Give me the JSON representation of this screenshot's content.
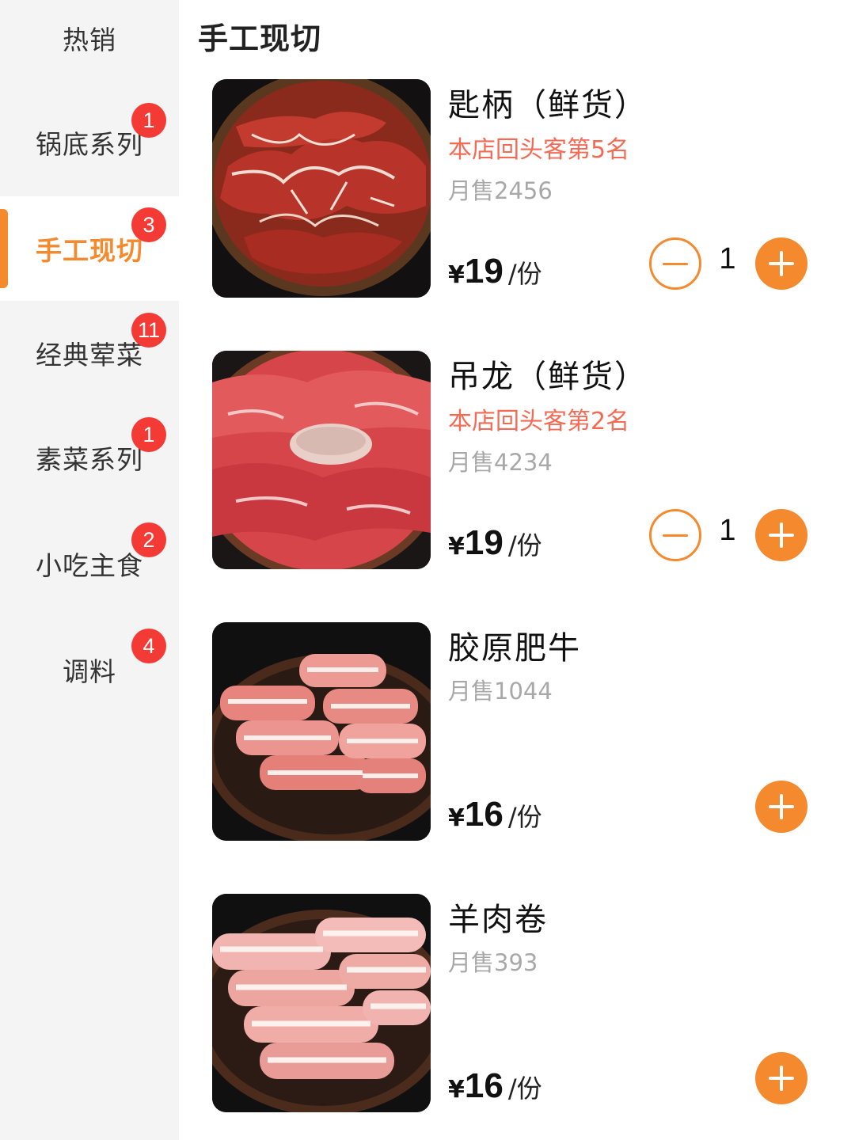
{
  "sidebar": {
    "categories": [
      {
        "label": "热销",
        "badge": ""
      },
      {
        "label": "锅底系列",
        "badge": "1"
      },
      {
        "label": "手工现切",
        "badge": "3",
        "active": true
      },
      {
        "label": "经典荤菜",
        "badge": "11"
      },
      {
        "label": "素菜系列",
        "badge": "1"
      },
      {
        "label": "小吃主食",
        "badge": "2"
      },
      {
        "label": "调料",
        "badge": "4"
      }
    ]
  },
  "section": {
    "title": "手工现切"
  },
  "products": [
    {
      "name": "匙柄（鲜货）",
      "rank": "本店回头客第5名",
      "sales": "月售2456",
      "currency": "¥",
      "price": "19",
      "unit": "/份",
      "quantity": "1",
      "image": "marbled-beef-plate"
    },
    {
      "name": "吊龙（鲜货）",
      "rank": "本店回头客第2名",
      "sales": "月售4234",
      "currency": "¥",
      "price": "19",
      "unit": "/份",
      "quantity": "1",
      "image": "sliced-beef-plate"
    },
    {
      "name": "胶原肥牛",
      "sales": "月售1044",
      "currency": "¥",
      "price": "16",
      "unit": "/份",
      "image": "beef-rolls-plate"
    },
    {
      "name": "羊肉卷",
      "sales": "月售393",
      "currency": "¥",
      "price": "16",
      "unit": "/份",
      "image": "lamb-rolls-plate"
    }
  ],
  "colors": {
    "accent": "#f5892e",
    "badge": "#f33a34",
    "rank": "#f36b55"
  }
}
